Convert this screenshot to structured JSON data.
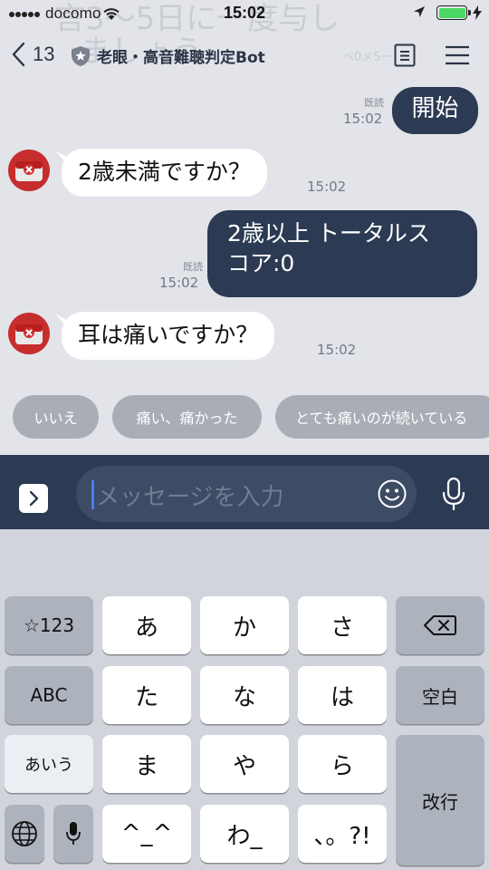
{
  "status_bar": {
    "carrier": "docomo",
    "time": "15:02",
    "battery_color": "#4cd964"
  },
  "background_banner": {
    "line1": "言3〜5日に一度与し",
    "line2": "ましょう",
    "time": "ベ0メ5ー"
  },
  "header": {
    "back_count": "13",
    "title": "老眼・高音難聴判定Bot",
    "icons": [
      "chevron-left-icon",
      "official-shield-icon",
      "note-icon",
      "hamburger-menu-icon"
    ]
  },
  "messages": [
    {
      "side": "out",
      "text": "開始",
      "read": "既読",
      "time": "15:02"
    },
    {
      "side": "in",
      "text": "2歳未満ですか？",
      "time": "15:02"
    },
    {
      "side": "out",
      "line1": "2歳以上 トータルス",
      "line2": "コア:0",
      "read": "既読",
      "time": "15:02"
    },
    {
      "side": "in",
      "text": "耳は痛いですか？",
      "time": "15:02"
    }
  ],
  "quick_replies": [
    "いいえ",
    "痛い、痛かった",
    "とても痛いのが続いている"
  ],
  "input": {
    "placeholder": "メッセージを入力"
  },
  "keyboard": {
    "row1": [
      "☆123",
      "あ",
      "か",
      "さ"
    ],
    "row2": [
      "ABC",
      "た",
      "な",
      "は",
      "空白"
    ],
    "row3": [
      "あいう",
      "ま",
      "や",
      "ら",
      "改行"
    ],
    "row4": [
      "^_^",
      "わ_",
      "、。?!"
    ],
    "accent_colors": {
      "bubble_out": "#2c3a53",
      "chip": "#a9adb6",
      "avatar": "#c62d2d"
    }
  }
}
